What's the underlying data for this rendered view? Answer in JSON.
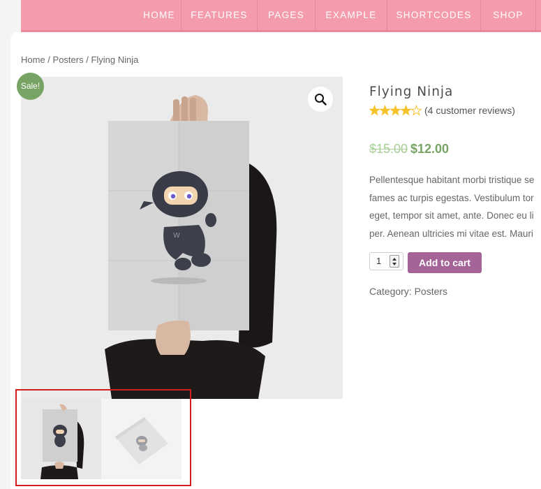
{
  "nav": {
    "items": [
      {
        "label": "HOME"
      },
      {
        "label": "FEATURES"
      },
      {
        "label": "PAGES"
      },
      {
        "label": "EXAMPLE"
      },
      {
        "label": "SHORTCODES"
      },
      {
        "label": "SHOP"
      }
    ]
  },
  "breadcrumb": {
    "home": "Home",
    "sep1": " / ",
    "category": "Posters",
    "sep2": " / ",
    "current": "Flying Ninja"
  },
  "product": {
    "sale_badge": "Sale!",
    "title": "Flying Ninja",
    "rating": 4,
    "rating_max": 5,
    "review_text": "(4 customer reviews)",
    "price_old": "$15.00",
    "price_new": "$12.00",
    "description_lines": [
      "Pellentesque habitant morbi tristique se",
      "fames ac turpis egestas. Vestibulum tor",
      "eget, tempor sit amet, ante. Donec eu li",
      "per. Aenean ultricies mi vitae est. Mauri"
    ],
    "quantity": "1",
    "add_to_cart": "Add to cart",
    "category_label": "Category: ",
    "category_value": "Posters"
  },
  "colors": {
    "nav_bg": "#f49cab",
    "sale_badge": "#77a464",
    "price_new": "#77a464",
    "price_old": "#a5cf96",
    "cart_button": "#a46497",
    "star": "#f5c22b",
    "highlight_box": "#d11f1f"
  },
  "icons": {
    "zoom": "magnifier-icon",
    "rating": "star-icon"
  }
}
